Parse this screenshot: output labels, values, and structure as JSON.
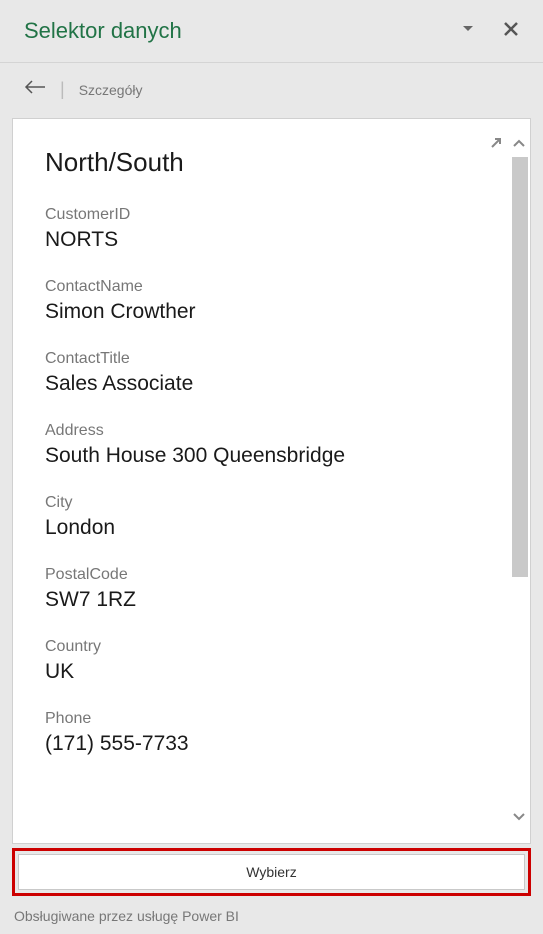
{
  "header": {
    "title": "Selektor danych"
  },
  "breadcrumb": {
    "label": "Szczegóły"
  },
  "record": {
    "title": "North/South",
    "fields": [
      {
        "label": "CustomerID",
        "value": "NORTS"
      },
      {
        "label": "ContactName",
        "value": "Simon Crowther"
      },
      {
        "label": "ContactTitle",
        "value": "Sales Associate"
      },
      {
        "label": "Address",
        "value": "South House 300 Queensbridge"
      },
      {
        "label": "City",
        "value": "London"
      },
      {
        "label": "PostalCode",
        "value": "SW7 1RZ"
      },
      {
        "label": "Country",
        "value": "UK"
      },
      {
        "label": "Phone",
        "value": "(171) 555-7733"
      }
    ]
  },
  "actions": {
    "select_label": "Wybierz"
  },
  "footer": {
    "powered_by": "Obsługiwane przez usługę Power BI"
  }
}
